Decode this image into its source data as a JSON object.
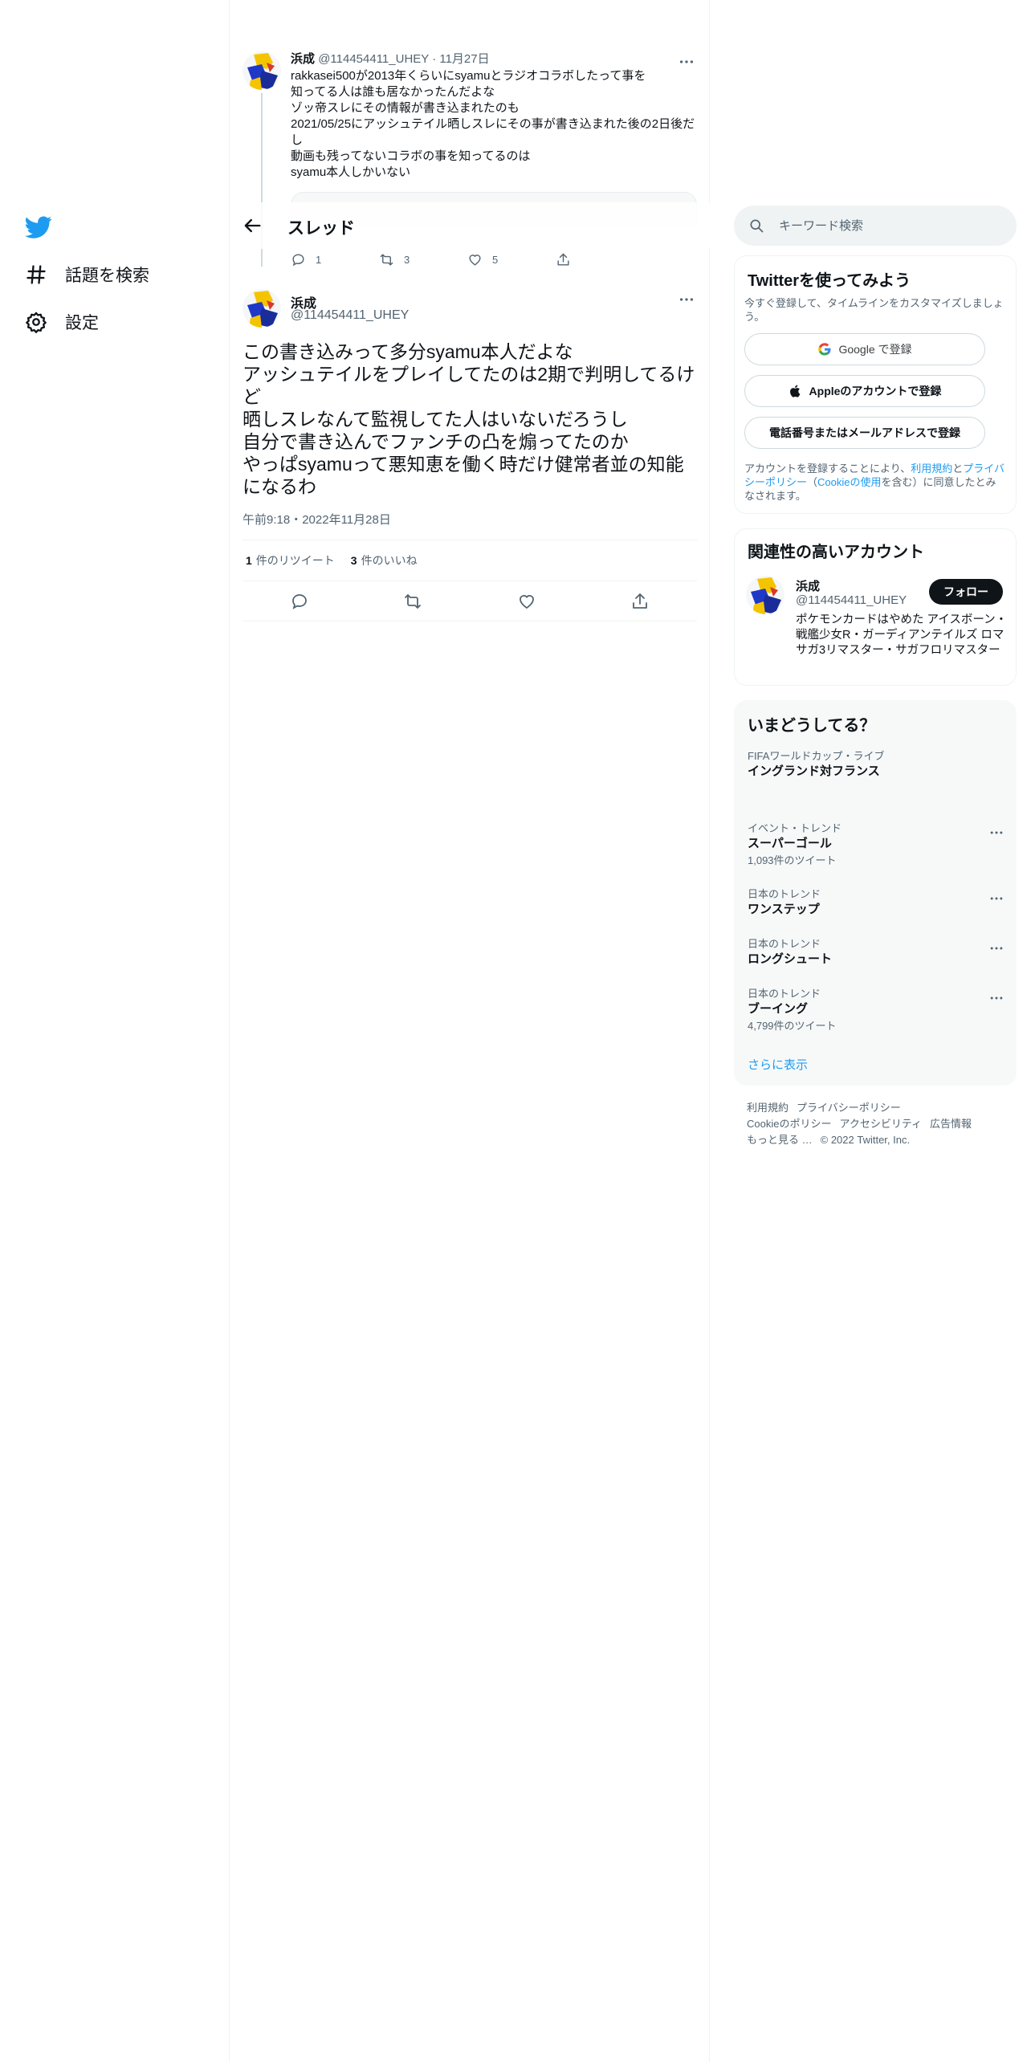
{
  "nav": {
    "items": [
      {
        "label": "話題を検索",
        "icon": "hashtag-icon"
      },
      {
        "label": "設定",
        "icon": "settings-gear-icon"
      }
    ]
  },
  "header": {
    "title": "スレッド"
  },
  "reply_tweet": {
    "name": "浜成",
    "handle": "@114454411_UHEY",
    "date": "11月27日",
    "text_lines": [
      "rakkasei500が2013年くらいにsyamuとラジオコラボしたって事を",
      "知ってる人は誰も居なかったんだよな",
      "ゾッ帝スレにその情報が書き込まれたのも",
      "2021/05/25にアッシュテイル晒しスレにその事が書き込まれた後の2日後だし",
      "動画も残ってないコラボの事を知ってるのは",
      "syamu本人しかいない"
    ],
    "reply_count": "1",
    "retweet_count": "3",
    "like_count": "5"
  },
  "focus_tweet": {
    "name": "浜成",
    "handle": "@114454411_UHEY",
    "text_lines": [
      "この書き込みって多分syamu本人だよな",
      "アッシュテイルをプレイしてたのは2期で判明してるけど",
      "晒しスレなんて監視してた人はいないだろうし",
      "自分で書き込んでファンチの凸を煽ってたのか",
      "やっぱsyamuって悪知恵を働く時だけ健常者並の知能になるわ"
    ],
    "timestamp": "午前9:18・2022年11月28日",
    "retweets": "1",
    "retweets_label": "件のリツイート",
    "likes": "3",
    "likes_label": "件のいいね"
  },
  "search": {
    "placeholder": "キーワード検索"
  },
  "signup": {
    "title": "Twitterを使ってみよう",
    "subtitle": "今すぐ登録して、タイムラインをカスタマイズしましょう。",
    "google_button": "Google で登録",
    "apple_button": "Appleのアカウントで登録",
    "phone_button": "電話番号またはメールアドレスで登録",
    "legal_prefix": "アカウントを登録することにより、",
    "legal_terms": "利用規約",
    "legal_and": "と",
    "legal_privacy": "プライバシーポリシー",
    "legal_open": "（",
    "legal_cookie": "Cookieの使用",
    "legal_suffix": "を含む）に同意したとみなされます。"
  },
  "related": {
    "title": "関連性の高いアカウント",
    "name": "浜成",
    "handle": "@114454411_UHEY",
    "bio": "ポケモンカードはやめた アイスボーン・戦艦少女R・ガーディアンテイルズ ロマサガ3リマスター・サガフロリマスター",
    "follow_label": "フォロー"
  },
  "trends": {
    "title": "いまどうしてる？",
    "items": [
      {
        "context": "FIFAワールドカップ・ライブ",
        "name": "イングランド対フランス",
        "count": ""
      },
      {
        "context": "イベント・トレンド",
        "name": "スーパーゴール",
        "count": "1,093件のツイート"
      },
      {
        "context": "日本のトレンド",
        "name": "ワンステップ",
        "count": ""
      },
      {
        "context": "日本のトレンド",
        "name": "ロングシュート",
        "count": ""
      },
      {
        "context": "日本のトレンド",
        "name": "ブーイング",
        "count": "4,799件のツイート"
      }
    ],
    "show_more": "さらに表示"
  },
  "footer": {
    "links": [
      "利用規約",
      "プライバシーポリシー",
      "Cookieのポリシー",
      "アクセシビリティ",
      "広告情報",
      "もっと見る …"
    ],
    "copyright": "© 2022 Twitter, Inc."
  },
  "colors": {
    "accent": "#1d9bf0",
    "text": "#0f1419",
    "secondary": "#536471",
    "border": "#eff3f4"
  }
}
